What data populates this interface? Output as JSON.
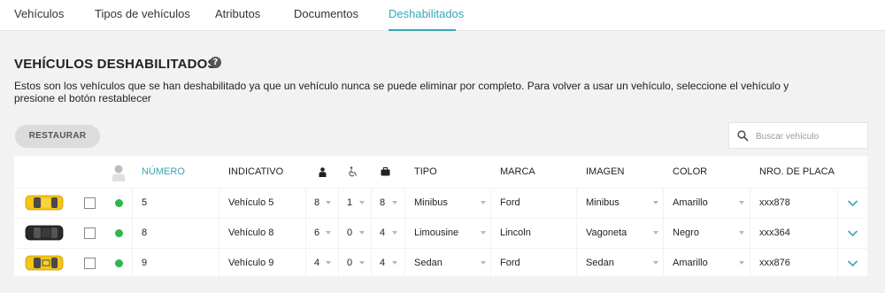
{
  "nav": {
    "tabs": [
      {
        "label": "Vehículos"
      },
      {
        "label": "Tipos de vehículos"
      },
      {
        "label": "Atributos"
      },
      {
        "label": "Documentos"
      },
      {
        "label": "Deshabilitados"
      }
    ],
    "active_tab": "Deshabilitados"
  },
  "page": {
    "title": "VEHÍCULOS DESHABILITADOS",
    "help_symbol": "?",
    "description": "Estos son los vehículos que se han deshabilitado ya que un vehículo nunca se puede eliminar por completo. Para volver a usar un vehículo, seleccione el vehículo y presione el botón restablecer"
  },
  "toolbar": {
    "restore_label": "RESTAURAR",
    "search_placeholder": "Buscar vehículo"
  },
  "colors": {
    "accent": "#3aa6b6",
    "status_active": "#2eb84b"
  },
  "table": {
    "headers": {
      "number": "NÚMERO",
      "callsign": "INDICATIVO",
      "seats_icon": "person-icon",
      "wheelchair_icon": "wheelchair-icon",
      "luggage_icon": "luggage-icon",
      "type": "TIPO",
      "brand": "MARCA",
      "image": "IMAGEN",
      "color": "COLOR",
      "plate": "NRO. DE PLACA"
    },
    "rows": [
      {
        "car_color": "yellow",
        "number": "5",
        "callsign": "Vehículo 5",
        "seats": "8",
        "wheelchair": "1",
        "luggage": "8",
        "type": "Minibus",
        "brand": "Ford",
        "image": "Minibus",
        "color": "Amarillo",
        "plate": "xxx878"
      },
      {
        "car_color": "black",
        "number": "8",
        "callsign": "Vehículo 8",
        "seats": "6",
        "wheelchair": "0",
        "luggage": "4",
        "type": "Limousine",
        "brand": "Lincoln",
        "image": "Vagoneta",
        "color": "Negro",
        "plate": "xxx364"
      },
      {
        "car_color": "yellow-taxi",
        "number": "9",
        "callsign": "Vehículo 9",
        "seats": "4",
        "wheelchair": "0",
        "luggage": "4",
        "type": "Sedan",
        "brand": "Ford",
        "image": "Sedan",
        "color": "Amarillo",
        "plate": "xxx876"
      }
    ]
  }
}
